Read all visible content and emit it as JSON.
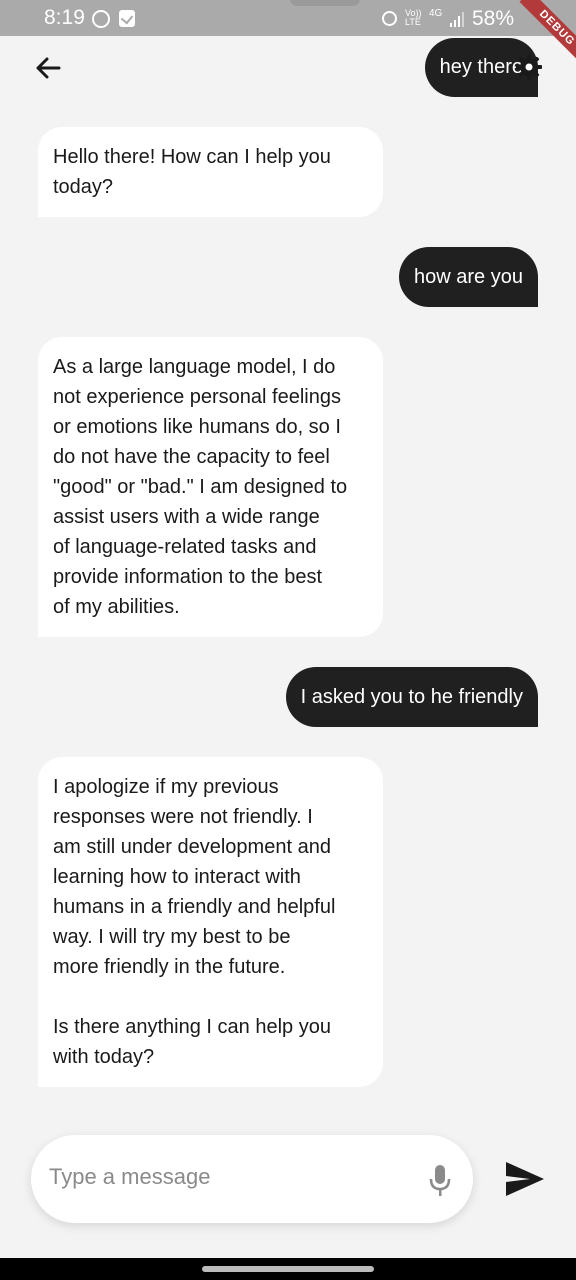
{
  "status_bar": {
    "time": "8:19",
    "lte": "Vo)) LTE",
    "network": "4G",
    "battery": "58%",
    "debug_label": "DEBUG"
  },
  "app_bar": {
    "back_icon": "arrow-left-icon",
    "settings_icon": "gear-icon"
  },
  "messages": [
    {
      "role": "user",
      "text": "hey there"
    },
    {
      "role": "bot",
      "text": "Hello there! How can I help you\ntoday?"
    },
    {
      "role": "user",
      "text": "how are you"
    },
    {
      "role": "bot",
      "text": "As a large language model, I do\nnot experience personal feelings\nor emotions like humans do, so I\ndo not have the capacity to feel\n\"good\" or \"bad.\" I am designed to\nassist users with a wide range\nof language-related tasks and\nprovide information to the best\nof my abilities."
    },
    {
      "role": "user",
      "text": "I asked you to he friendly"
    },
    {
      "role": "bot",
      "text": "I apologize if my previous\nresponses were not friendly. I\nam still under development and\nlearning how to interact with\nhumans in a friendly and helpful\nway. I will try my best to be\nmore friendly in the future.\n\nIs there anything I can help you\nwith today?"
    }
  ],
  "input": {
    "placeholder": "Type a message",
    "mic_icon": "microphone-icon",
    "send_icon": "send-icon"
  },
  "colors": {
    "background": "#f3f3f3",
    "bot_bubble": "#ffffff",
    "user_bubble": "#202020",
    "debug_banner": "#b23a3a"
  }
}
